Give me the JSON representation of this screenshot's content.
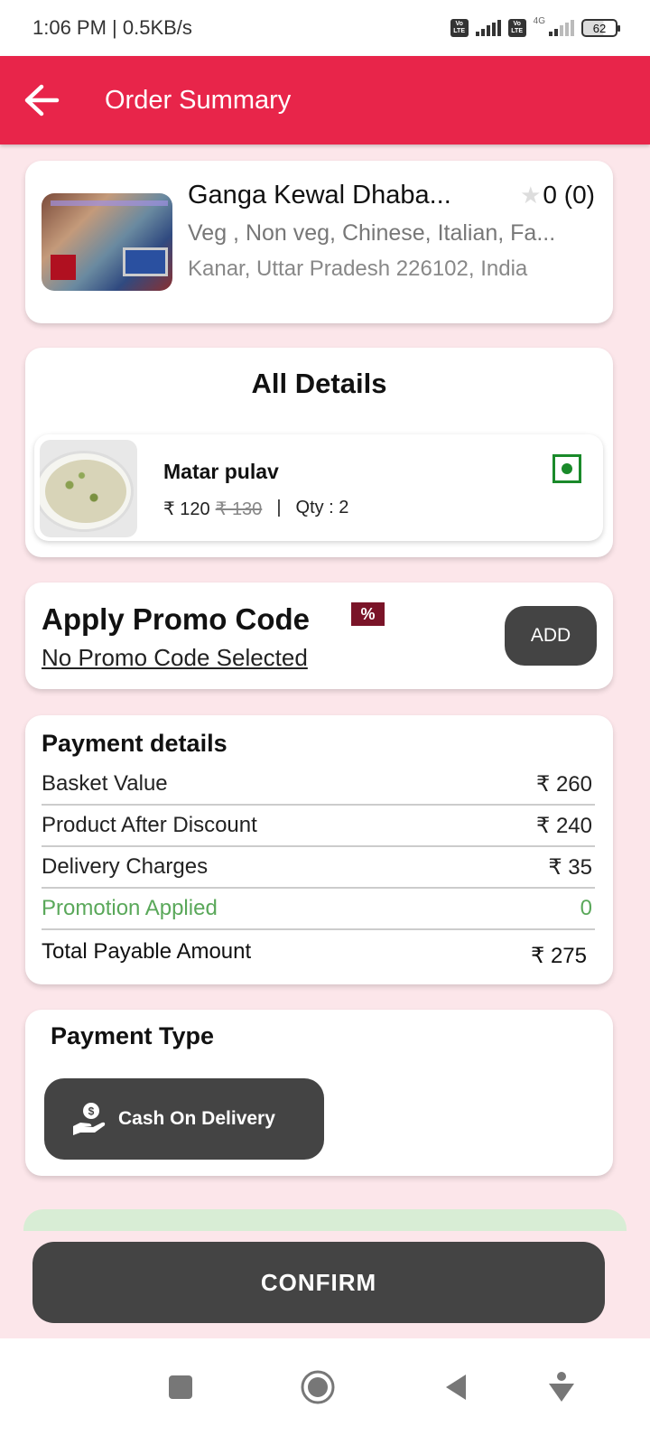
{
  "status_bar": {
    "time_speed": "1:06 PM | 0.5KB/s",
    "volte_label_top": "Vo",
    "volte_label_bottom": "LTE",
    "network_type": "4G",
    "battery_level": "62"
  },
  "app_bar": {
    "title": "Order Summary",
    "back_icon": "arrow-left-icon",
    "color": "#e8254a"
  },
  "restaurant": {
    "name": "Ganga Kewal Dhaba...",
    "rating": "0 (0)",
    "cuisines": "Veg , Non veg, Chinese, Italian, Fa...",
    "address": "Kanar, Uttar Pradesh 226102, India"
  },
  "details": {
    "title": "All Details",
    "items": [
      {
        "name": "Matar pulav",
        "price": "₹ 120",
        "original_price": "₹ 130",
        "separator": "|",
        "qty": "Qty : 2",
        "veg": true
      }
    ]
  },
  "promo": {
    "title": "Apply Promo Code",
    "icon_glyph": "%",
    "status": "No Promo Code Selected",
    "add_label": "ADD"
  },
  "payment_details": {
    "title": "Payment details",
    "rows": [
      {
        "label": "Basket Value",
        "value": "₹ 260"
      },
      {
        "label": "Product After Discount",
        "value": "₹ 240"
      },
      {
        "label": "Delivery Charges",
        "value": "₹ 35"
      },
      {
        "label": "Promotion Applied",
        "value": "0"
      },
      {
        "label": "Total Payable Amount",
        "value": "₹ 275"
      }
    ],
    "promotion_color": "#5aa85a"
  },
  "payment_type": {
    "title": "Payment Type",
    "option_label": "Cash On Delivery"
  },
  "confirm_label": "CONFIRM"
}
